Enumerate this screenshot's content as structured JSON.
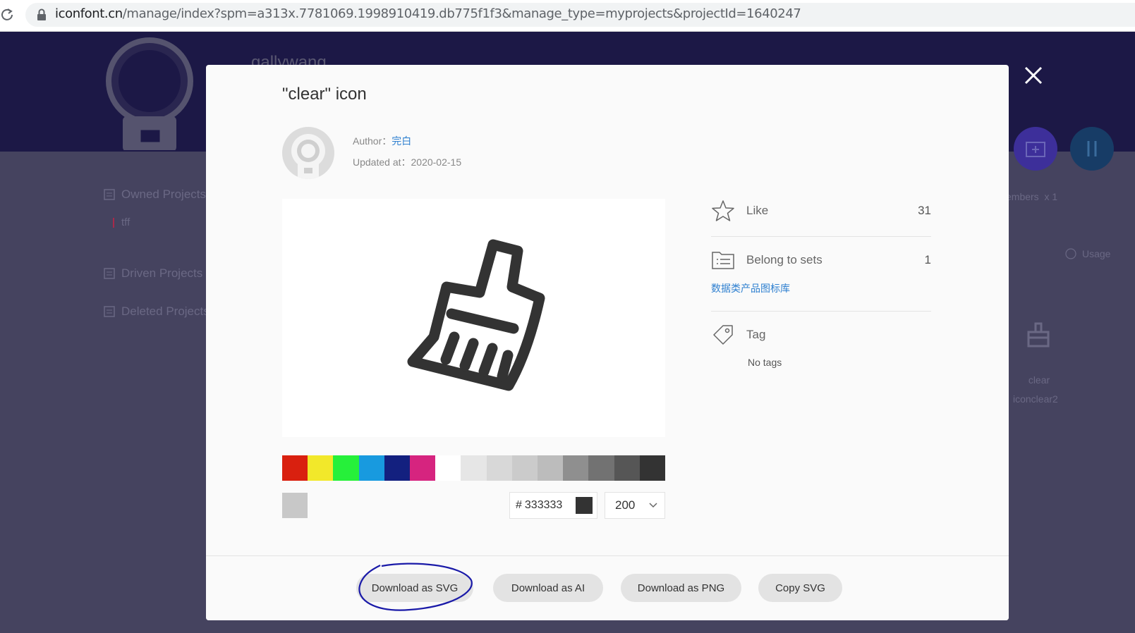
{
  "browser": {
    "url_host": "iconfont.cn",
    "url_rest": "/manage/index?spm=a313x.7781069.1998910419.db775f1f3&manage_type=myprojects&projectId=1640247"
  },
  "background": {
    "username": "gallywang",
    "sidebar": [
      "Owned Projects",
      "Driven Projects",
      "Deleted Projects"
    ],
    "project": "tff",
    "members_text": "embers",
    "members_count": "x 1",
    "usage": "Usage",
    "icon_name": "clear",
    "icon_code": "iconclear2"
  },
  "modal": {
    "title": "\"clear\" icon",
    "author_label": "Author：",
    "author_name": "完白",
    "updated_label": "Updated at：",
    "updated_date": "2020-02-15",
    "palette": [
      "#d9200f",
      "#f2e82a",
      "#26f03a",
      "#189adf",
      "#13207f",
      "#d6247f",
      "#ffffff",
      "#e6e6e6",
      "#d8d8d8",
      "#cbcbcb",
      "#bcbcbc",
      "#8f8f8f",
      "#727272",
      "#565656",
      "#333333"
    ],
    "hex_prefix": "#",
    "hex_value": "333333",
    "size_value": "200",
    "like_label": "Like",
    "like_count": "31",
    "sets_label": "Belong to sets",
    "sets_count": "1",
    "set_name": "数据类产品图标库",
    "tag_label": "Tag",
    "no_tags": "No tags",
    "buttons": [
      "Download as SVG",
      "Download as AI",
      "Download as PNG",
      "Copy SVG"
    ],
    "icon_color": "#333333",
    "annotation_color": "#1a1aa8"
  }
}
